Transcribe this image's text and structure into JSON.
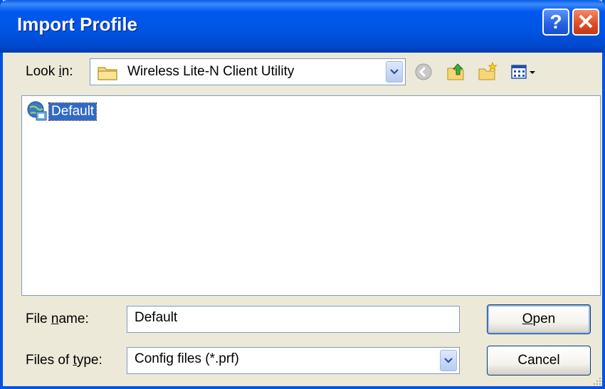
{
  "window": {
    "title": "Import Profile",
    "help_glyph": "?",
    "close_glyph": "✕"
  },
  "look_in": {
    "label_pre": "Look ",
    "label_accel": "i",
    "label_post": "n:",
    "value": "Wireless Lite-N Client Utility",
    "icon": "folder-icon"
  },
  "toolbar": {
    "icons": [
      "back-arrow-icon",
      "up-folder-icon",
      "new-folder-icon",
      "view-menu-icon"
    ]
  },
  "file_list": {
    "items": [
      {
        "label": "Default",
        "icon": "network-profile-icon",
        "selected": true
      }
    ]
  },
  "file_name": {
    "label_pre": "File ",
    "label_accel": "n",
    "label_post": "ame:",
    "value": "Default"
  },
  "file_type": {
    "label_pre": "Files of ",
    "label_accel": "t",
    "label_post": "ype:",
    "value": "Config files (*.prf)"
  },
  "buttons": {
    "open_accel": "O",
    "open_rest": "pen",
    "cancel": "Cancel"
  },
  "colors": {
    "titlebar": "#0054e3",
    "selection": "#316ac5",
    "dialog_bg": "#ece9d8"
  }
}
